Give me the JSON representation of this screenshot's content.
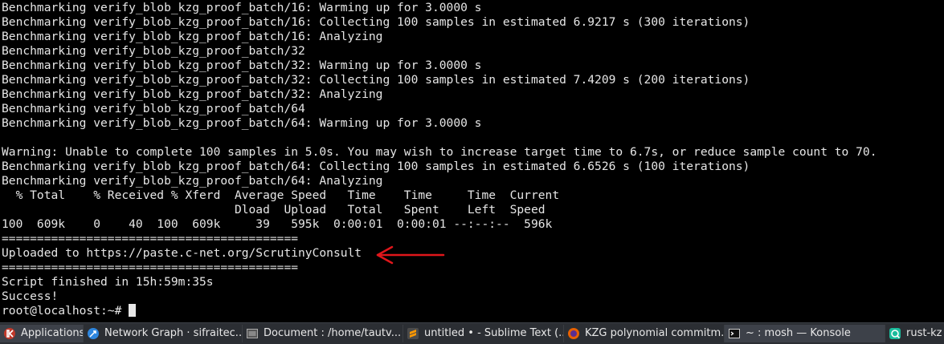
{
  "terminal": {
    "lines": [
      "Benchmarking verify_blob_kzg_proof_batch/16: Warming up for 3.0000 s",
      "Benchmarking verify_blob_kzg_proof_batch/16: Collecting 100 samples in estimated 6.9217 s (300 iterations)",
      "Benchmarking verify_blob_kzg_proof_batch/16: Analyzing",
      "Benchmarking verify_blob_kzg_proof_batch/32",
      "Benchmarking verify_blob_kzg_proof_batch/32: Warming up for 3.0000 s",
      "Benchmarking verify_blob_kzg_proof_batch/32: Collecting 100 samples in estimated 7.4209 s (200 iterations)",
      "Benchmarking verify_blob_kzg_proof_batch/32: Analyzing",
      "Benchmarking verify_blob_kzg_proof_batch/64",
      "Benchmarking verify_blob_kzg_proof_batch/64: Warming up for 3.0000 s",
      "",
      "Warning: Unable to complete 100 samples in 5.0s. You may wish to increase target time to 6.7s, or reduce sample count to 70.",
      "Benchmarking verify_blob_kzg_proof_batch/64: Collecting 100 samples in estimated 6.6526 s (100 iterations)",
      "Benchmarking verify_blob_kzg_proof_batch/64: Analyzing",
      "  % Total    % Received % Xferd  Average Speed   Time    Time     Time  Current",
      "                                 Dload  Upload   Total   Spent    Left  Speed",
      "100  609k    0    40  100  609k     39   595k  0:00:01  0:00:01 --:--:--  596k",
      "==========================================",
      "Uploaded to https://paste.c-net.org/ScrutinyConsult",
      "==========================================",
      "Script finished in 15h:59m:35s",
      "Success!"
    ],
    "prompt": "root@localhost:~# ",
    "arrow_color": "#e0161b"
  },
  "taskbar": {
    "items": [
      {
        "icon": "kde-menu-icon",
        "label": "Applications",
        "active": true
      },
      {
        "icon": "browser-icon",
        "label": "Network Graph · sifraitec..."
      },
      {
        "icon": "document-icon",
        "label": "Document : /home/tautv..."
      },
      {
        "icon": "sublime-text-icon",
        "label": "untitled • - Sublime Text (..."
      },
      {
        "icon": "firefox-icon",
        "label": "KZG polynomial commitm..."
      },
      {
        "icon": "terminal-icon",
        "label": "~ : mosh — Konsole"
      },
      {
        "icon": "rust-app-icon",
        "label": "rust-kz"
      }
    ]
  }
}
